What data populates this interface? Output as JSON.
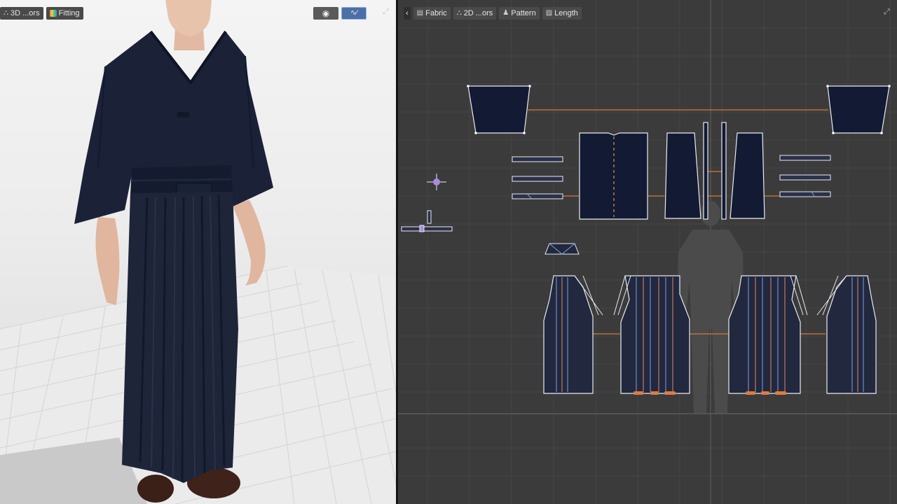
{
  "viewport3d": {
    "toolbar": {
      "objects_label": "3D ...ors",
      "fitting_label": "Fitting"
    },
    "view_buttons": [
      {
        "icon": "circle-target-icon"
      },
      {
        "icon": "wave-avatar-icon"
      }
    ],
    "expand_icon": "expand-icon"
  },
  "viewport2d": {
    "toolbar": {
      "collapse_icon": "chevron-left-icon",
      "fabric_label": "Fabric",
      "colors_label": "2D ...ors",
      "pattern_label": "Pattern",
      "length_label": "Length"
    },
    "expand_icon": "expand-icon"
  },
  "colors": {
    "pattern_fill": "#131a33",
    "pattern_fill_alt": "#22283d",
    "outline": "#e8ecf4",
    "seam_line": "#d27a38",
    "pleat_blue": "#7fa0e8",
    "pleat_orange": "#e08a6a",
    "grid_major": "#4a4a4a",
    "avatar_silhouette": "#4b4b4b",
    "pin_purple": "#a98be0"
  }
}
